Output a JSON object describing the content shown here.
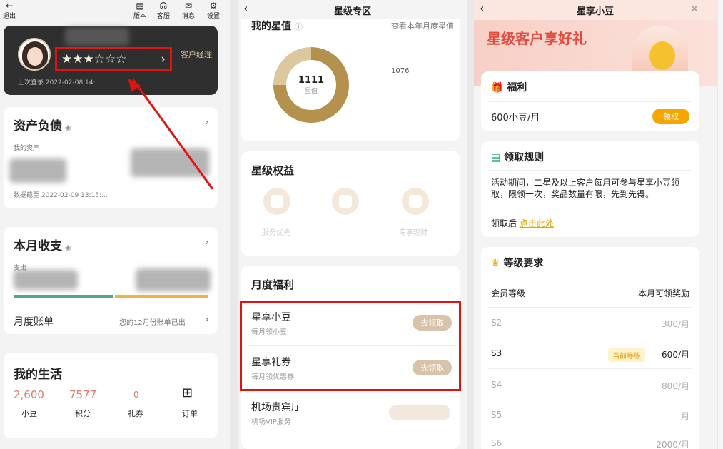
{
  "panel1": {
    "toolbar": {
      "logout": "退出",
      "version": "版本",
      "service": "客服",
      "message": "消息",
      "settings": "设置"
    },
    "account": {
      "manager": "客户经理",
      "last_login": "上次登录 2022-02-08 14:..."
    },
    "assets": {
      "title": "资产负债",
      "my_assets": "我的资产",
      "date": "数据截至 2022-02-09 13:15:..."
    },
    "monthly": {
      "title": "本月收支",
      "expense": "支出",
      "bill_title": "月度账单",
      "bill_note": "您的12月份账单已出"
    },
    "life": {
      "title": "我的生活",
      "items": [
        {
          "value": "2,600",
          "label": "小豆"
        },
        {
          "value": "7577",
          "label": "积分"
        },
        {
          "value": "0",
          "label": "礼券"
        },
        {
          "value": "",
          "label": "订单"
        }
      ]
    }
  },
  "panel2": {
    "title": "星级专区",
    "value_card": {
      "title": "我的星值",
      "link": "查看本年月度星值",
      "value": "1111",
      "value_label": "星值",
      "side_value": "1076"
    },
    "rights": {
      "title": "星级权益",
      "items": [
        {
          "label": "服务优先"
        },
        {
          "label": "专享理财"
        }
      ]
    },
    "monthly": {
      "title": "月度福利",
      "items": [
        {
          "title": "星享小豆",
          "sub": "每月领小豆",
          "btn": "去领取"
        },
        {
          "title": "星享礼券",
          "sub": "每月领优惠券",
          "btn": "去领取"
        },
        {
          "title": "机场贵宾厅",
          "sub": "机场VIP服务"
        }
      ]
    }
  },
  "panel3": {
    "title": "星享小豆",
    "banner": "星级客户享好礼",
    "benefit": {
      "title": "福利",
      "amount": "600小豆/月",
      "btn": "领取"
    },
    "rules": {
      "title": "领取规则",
      "text": "活动期间，二星及以上客户每月可参与星享小豆领取，限领一次，奖品数量有限，先到先得。",
      "after": "领取后",
      "link": "点击此处"
    },
    "levels": {
      "title": "等级要求",
      "col1": "会员等级",
      "col2": "本月可领奖励",
      "current": "当前等级",
      "rows": [
        {
          "level": "S2",
          "reward": "300/月"
        },
        {
          "level": "S3",
          "reward": "600/月"
        },
        {
          "level": "S4",
          "reward": "800/月"
        },
        {
          "level": "S5",
          "reward": "月"
        },
        {
          "level": "S6",
          "reward": "2000/月"
        }
      ]
    }
  }
}
